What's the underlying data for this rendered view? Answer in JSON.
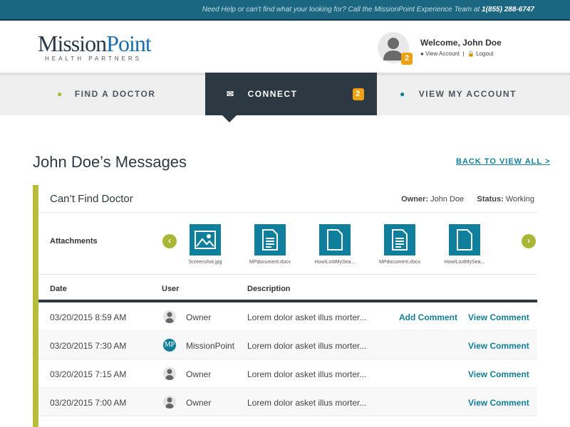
{
  "topbar": {
    "help_text": "Need Help or can't find what your looking for? Call the MissionPoint Experience Team at",
    "phone": "1(855) 288-6747"
  },
  "header": {
    "logo_main_a": "Mission",
    "logo_main_b": "Point",
    "logo_sub": "HEALTH PARTNERS",
    "welcome": "Welcome, John Doe",
    "view_account": "View Account",
    "separator": "|",
    "logout": "Logout",
    "notification_count": "2"
  },
  "nav": {
    "tabs": [
      {
        "label": "FIND A DOCTOR"
      },
      {
        "label": "CONNECT",
        "badge": "2"
      },
      {
        "label": "VIEW MY ACCOUNT"
      }
    ]
  },
  "page": {
    "title": "John Doe’s Messages",
    "back_link": "BACK TO VIEW ALL >"
  },
  "message": {
    "subject": "Can’t Find Doctor",
    "owner_label": "Owner:",
    "owner": "John Doe",
    "status_label": "Status:",
    "status": "Working",
    "attachments_label": "Attachments",
    "prev": "‹",
    "next": "›",
    "attachments": [
      {
        "name": "Screenshot.jpg",
        "icon": "image-icon"
      },
      {
        "name": "MPdocument.docx",
        "icon": "document-icon"
      },
      {
        "name": "HowILostMySea...",
        "icon": "blank-file-icon"
      },
      {
        "name": "MPdocument.docx",
        "icon": "document-icon"
      },
      {
        "name": "HowILostMySea...",
        "icon": "blank-file-icon"
      }
    ]
  },
  "table": {
    "headers": {
      "date": "Date",
      "user": "User",
      "description": "Description"
    },
    "rows": [
      {
        "date": "03/20/2015 8:59 AM",
        "user": "Owner",
        "avatar": "user",
        "description": "Lorem dolor asket illus morter...",
        "add": "Add Comment",
        "view": "View Comment"
      },
      {
        "date": "03/20/2015 7:30 AM",
        "user": "MissionPoint",
        "avatar": "MP",
        "description": "Lorem dolor asket illus morter...",
        "view": "View Comment"
      },
      {
        "date": "03/20/2015 7:15 AM",
        "user": "Owner",
        "avatar": "user",
        "description": "Lorem dolor asket illus morter...",
        "view": "View Comment"
      },
      {
        "date": "03/20/2015 7:00 AM",
        "user": "Owner",
        "avatar": "user",
        "description": "Lorem dolor asket illus morter...",
        "view": "View Comment"
      }
    ]
  }
}
